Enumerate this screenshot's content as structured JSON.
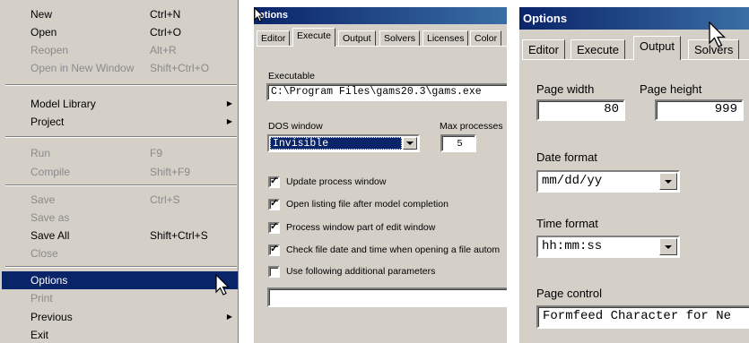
{
  "file_menu": {
    "items": [
      {
        "label": "New",
        "shortcut": "Ctrl+N"
      },
      {
        "label": "Open",
        "shortcut": "Ctrl+O"
      },
      {
        "label": "Reopen",
        "shortcut": "Alt+R"
      },
      {
        "label": "Open in New Window",
        "shortcut": "Shift+Ctrl+O"
      },
      {
        "label": "Model Library",
        "shortcut": ""
      },
      {
        "label": "Project",
        "shortcut": ""
      },
      {
        "label": "Run",
        "shortcut": "F9"
      },
      {
        "label": "Compile",
        "shortcut": "Shift+F9"
      },
      {
        "label": "Save",
        "shortcut": "Ctrl+S"
      },
      {
        "label": "Save as",
        "shortcut": ""
      },
      {
        "label": "Save All",
        "shortcut": "Shift+Ctrl+S"
      },
      {
        "label": "Close",
        "shortcut": ""
      },
      {
        "label": "Options",
        "shortcut": ""
      },
      {
        "label": "Print",
        "shortcut": ""
      },
      {
        "label": "Previous",
        "shortcut": ""
      },
      {
        "label": "Exit",
        "shortcut": ""
      }
    ]
  },
  "execute_dialog": {
    "title": "ptions",
    "tabs": [
      "Editor",
      "Execute",
      "Output",
      "Solvers",
      "Licenses",
      "Color"
    ],
    "active_tab": "Execute",
    "executable_label": "Executable",
    "executable_value": "C:\\Program Files\\gams20.3\\gams.exe",
    "dos_window_label": "DOS window",
    "dos_window_value": "Invisible",
    "max_processes_label": "Max processes",
    "max_processes_value": "5",
    "checkboxes": [
      {
        "label": "Update process window",
        "checked": true
      },
      {
        "label": "Open listing file after model completion",
        "checked": true
      },
      {
        "label": "Process window part of edit window",
        "checked": true
      },
      {
        "label": "Check file date and time when opening a file autom",
        "checked": true
      },
      {
        "label": "Use following additional parameters",
        "checked": false
      }
    ],
    "additional_parameters_value": ""
  },
  "output_dialog": {
    "title": "Options",
    "tabs": [
      "Editor",
      "Execute",
      "Output",
      "Solvers"
    ],
    "active_tab": "Output",
    "page_width_label": "Page width",
    "page_width_value": "80",
    "page_height_label": "Page height",
    "page_height_value": "999",
    "date_format_label": "Date format",
    "date_format_value": "mm/dd/yy",
    "time_format_label": "Time format",
    "time_format_value": "hh:mm:ss",
    "page_control_label": "Page control",
    "page_control_value": "Formfeed Character for Ne"
  },
  "colors": {
    "menu_bg": "#d4d0c8",
    "selection": "#0a246a",
    "disabled_text": "#8a8a8a"
  }
}
